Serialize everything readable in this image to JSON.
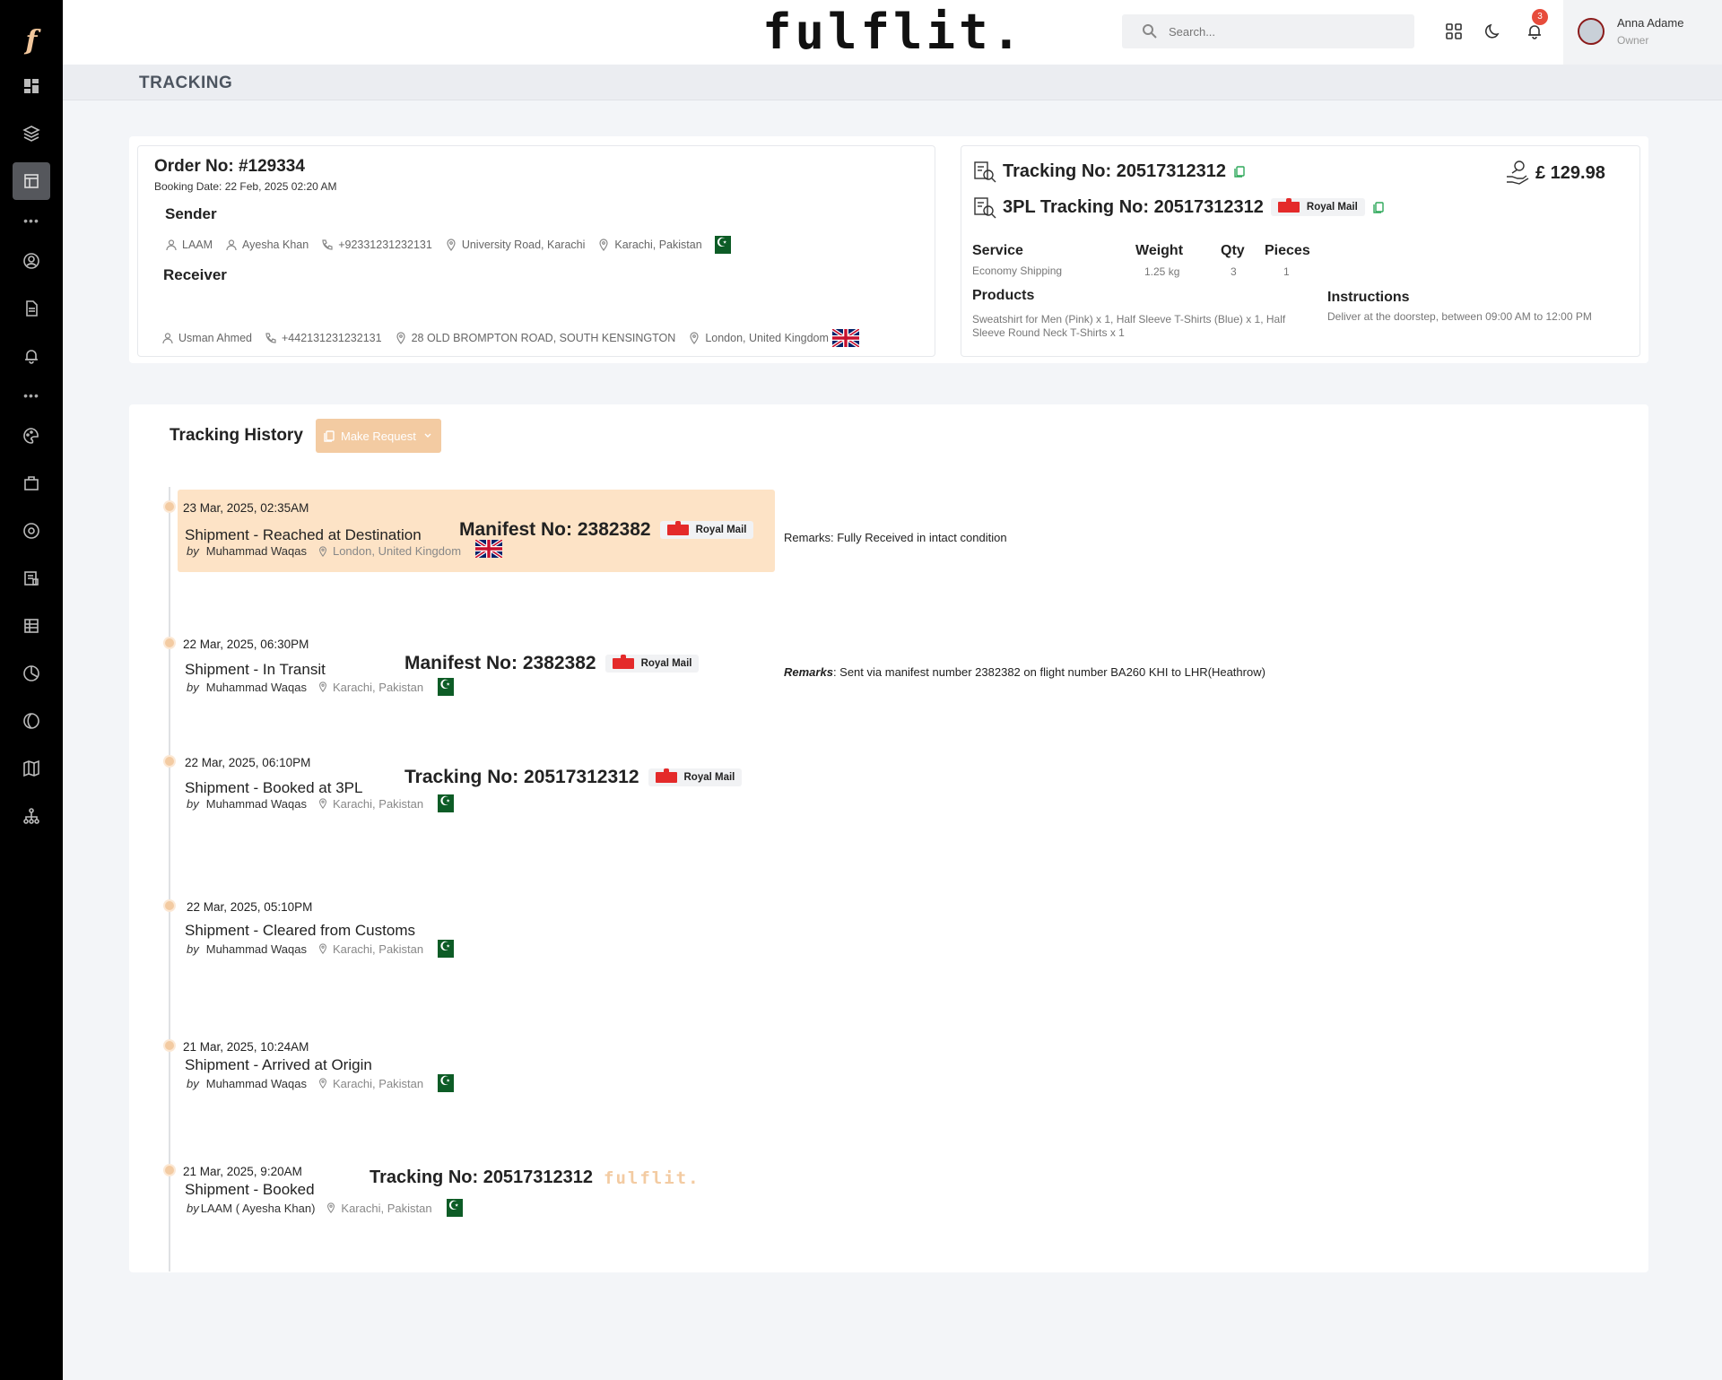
{
  "brand": "fulflit.",
  "sidebar": {
    "logo": "f",
    "items": [
      "dashboard-icon",
      "layers-icon",
      "layout-icon",
      "user-circle-icon",
      "file-icon",
      "bell-icon",
      "palette-icon",
      "briefcase-icon",
      "aperture-icon",
      "document-icon",
      "grid-icon",
      "pie-icon",
      "globe-icon",
      "map-icon",
      "sitemap-icon"
    ],
    "active": "layout-icon"
  },
  "header": {
    "search_placeholder": "Search...",
    "notifications_count": "3",
    "user_name": "Anna Adame",
    "user_role": "Owner"
  },
  "page_title": "TRACKING",
  "order": {
    "order_no": "Order No: #129334",
    "booking_date": "Booking Date: 22 Feb, 2025 02:20 AM",
    "sender_label": "Sender",
    "sender": {
      "company": "LAAM",
      "name": "Ayesha Khan",
      "phone": "+92331231232131",
      "address": "University Road, Karachi",
      "city": "Karachi, Pakistan"
    },
    "receiver_label": "Receiver",
    "receiver": {
      "name": "Usman Ahmed",
      "phone": "+442131231232131",
      "address": "28 OLD BROMPTON ROAD, SOUTH KENSINGTON",
      "city": "London, United Kingdom"
    }
  },
  "tracking": {
    "tracking_no": "Tracking No: 20517312312",
    "tpl_tracking_no": "3PL Tracking No: 20517312312",
    "carrier": "Royal Mail",
    "price": "£ 129.98",
    "service_label": "Service",
    "service_value": "Economy Shipping",
    "weight_label": "Weight",
    "weight_value": "1.25 kg",
    "qty_label": "Qty",
    "qty_value": "3",
    "pieces_label": "Pieces",
    "pieces_value": "1",
    "products_label": "Products",
    "products_line1": "Sweatshirt for Men (Pink) x 1, Half Sleeve T-Shirts (Blue) x 1, Half",
    "products_line2": "Sleeve Round Neck T-Shirts x 1",
    "instructions_label": "Instructions",
    "instructions_value": "Deliver at the doorstep, between 09:00 AM to 12:00 PM"
  },
  "history": {
    "title": "Tracking History",
    "make_request": "Make Request",
    "by_label": "by",
    "remarks_label": "Remarks",
    "events": [
      {
        "date": "23 Mar, 2025, 02:35AM",
        "title": "Shipment - Reached at Destination",
        "by": "Muhammad Waqas",
        "location": "London, United Kingdom",
        "ref": "Manifest No: 2382382",
        "carrier": "Royal Mail",
        "remarks": "Remarks: Fully Received in intact condition"
      },
      {
        "date": "22 Mar, 2025, 06:30PM",
        "title": "Shipment - In Transit",
        "by": "Muhammad Waqas",
        "location": "Karachi, Pakistan",
        "ref": "Manifest No: 2382382",
        "carrier": "Royal Mail",
        "remarks": ": Sent via manifest number 2382382 on flight number BA260 KHI to  LHR(Heathrow)"
      },
      {
        "date": "22 Mar, 2025, 06:10PM",
        "title": "Shipment - Booked at 3PL",
        "by": "Muhammad Waqas",
        "location": "Karachi, Pakistan",
        "ref": "Tracking No: 20517312312",
        "carrier": "Royal Mail"
      },
      {
        "date": "22 Mar, 2025, 05:10PM",
        "title": "Shipment - Cleared from Customs",
        "by": "Muhammad Waqas",
        "location": "Karachi, Pakistan"
      },
      {
        "date": "21 Mar, 2025, 10:24AM",
        "title": "Shipment - Arrived at Origin",
        "by": "Muhammad Waqas",
        "location": "Karachi, Pakistan"
      },
      {
        "date": "21 Mar, 2025, 9:20AM",
        "title": "Shipment - Booked",
        "by": "LAAM ( Ayesha Khan)",
        "location": "Karachi, Pakistan",
        "ref": "Tracking No: 20517312312",
        "carrier_brand": "fulflit."
      }
    ]
  },
  "colors": {
    "accent": "#f3cba2",
    "highlight": "#fde3c6",
    "sidebar": "#000000",
    "royal_mail": "#e42a2a"
  }
}
